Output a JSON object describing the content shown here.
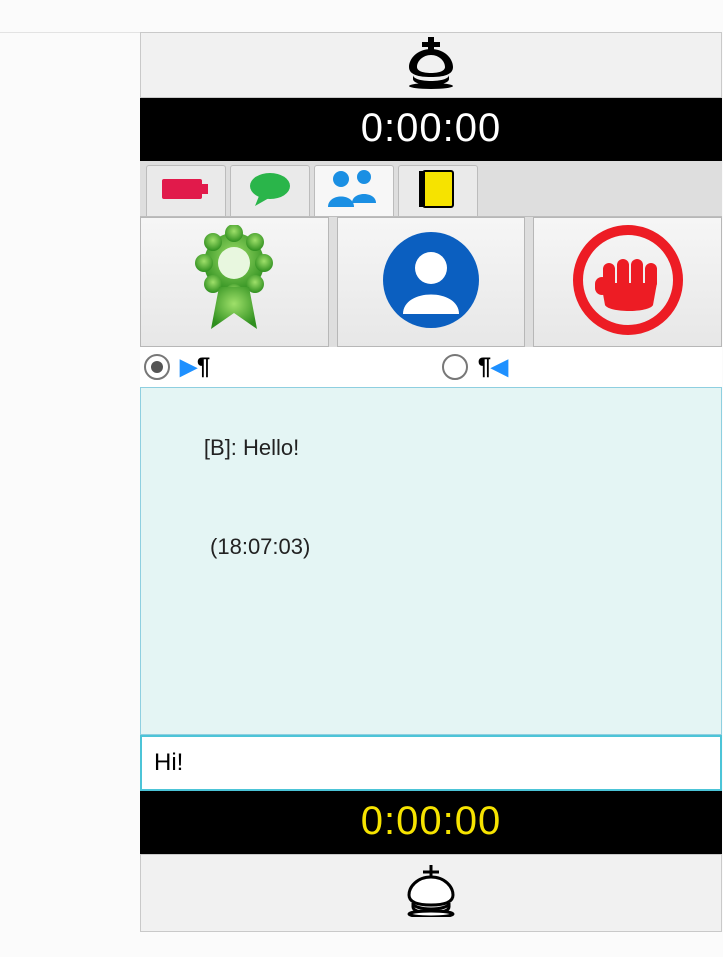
{
  "top_player": {
    "piece_color": "black",
    "clock": "0:00:00"
  },
  "bottom_player": {
    "piece_color": "white",
    "clock": "0:00:00"
  },
  "tabs": {
    "battery": {
      "icon": "battery-icon",
      "color": "#e11a4b"
    },
    "chat": {
      "icon": "speech-icon",
      "color": "#2ab54a"
    },
    "users": {
      "icon": "users-icon",
      "color": "#1a8fe3",
      "selected": true
    },
    "notebook": {
      "icon": "notebook-icon",
      "color": "#f6e300"
    }
  },
  "big_buttons": {
    "award": {
      "icon": "award-rosette-icon"
    },
    "profile": {
      "icon": "profile-circle-icon"
    },
    "fight": {
      "icon": "fist-circle-icon"
    }
  },
  "text_direction": {
    "ltr_selected": true,
    "rtl_selected": false
  },
  "chat": {
    "messages": [
      {
        "prefix": "[B]: ",
        "text": "Hello!",
        "time": "(18:07:03)"
      }
    ],
    "input_value": "Hi!"
  }
}
